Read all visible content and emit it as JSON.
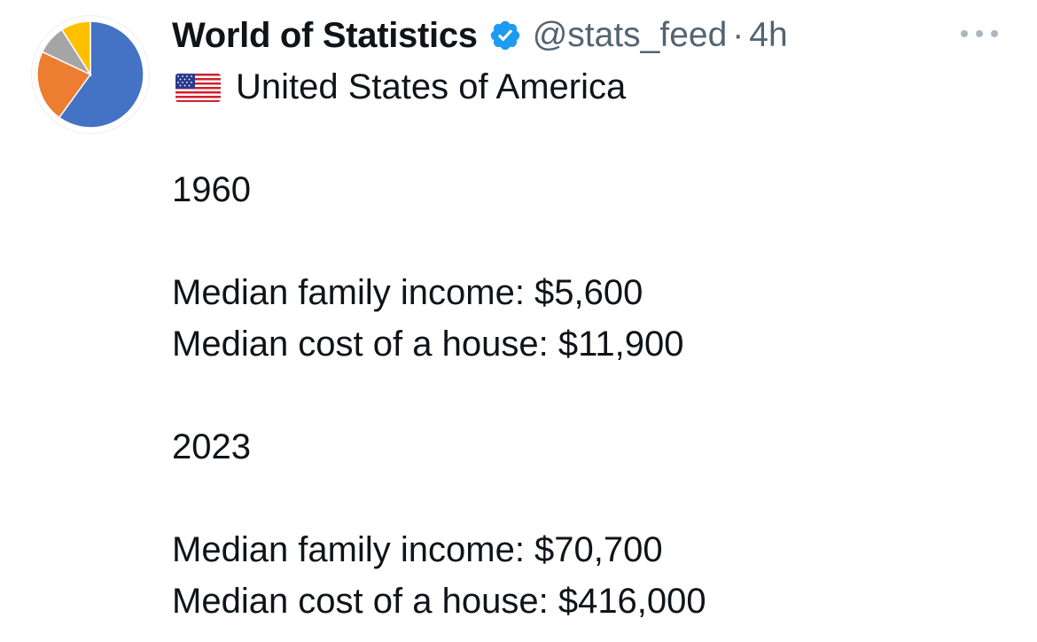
{
  "author": {
    "display_name": "World of Statistics",
    "handle": "@stats_feed",
    "separator": "·",
    "time": "4h",
    "verified": true,
    "avatar": {
      "slices": [
        {
          "color": "#4472C4",
          "share": 0.6
        },
        {
          "color": "#ED7D31",
          "share": 0.22
        },
        {
          "color": "#A5A5A5",
          "share": 0.09
        },
        {
          "color": "#FFC000",
          "share": 0.09
        }
      ]
    }
  },
  "tweet": {
    "flag_icon": "us-flag-icon",
    "lines": {
      "country": "United States of America",
      "year_1": "1960",
      "income_1": "Median family income: $5,600",
      "house_1": "Median cost of a house: $11,900",
      "year_2": "2023",
      "income_2": "Median family income: $70,700",
      "house_2": "Median cost of a house: $416,000"
    }
  },
  "icons": {
    "verified": "verified-badge-icon",
    "more": "more-options-icon"
  },
  "colors": {
    "text_primary": "#0f1419",
    "text_secondary": "#536471",
    "verified_blue": "#1d9bf0"
  }
}
